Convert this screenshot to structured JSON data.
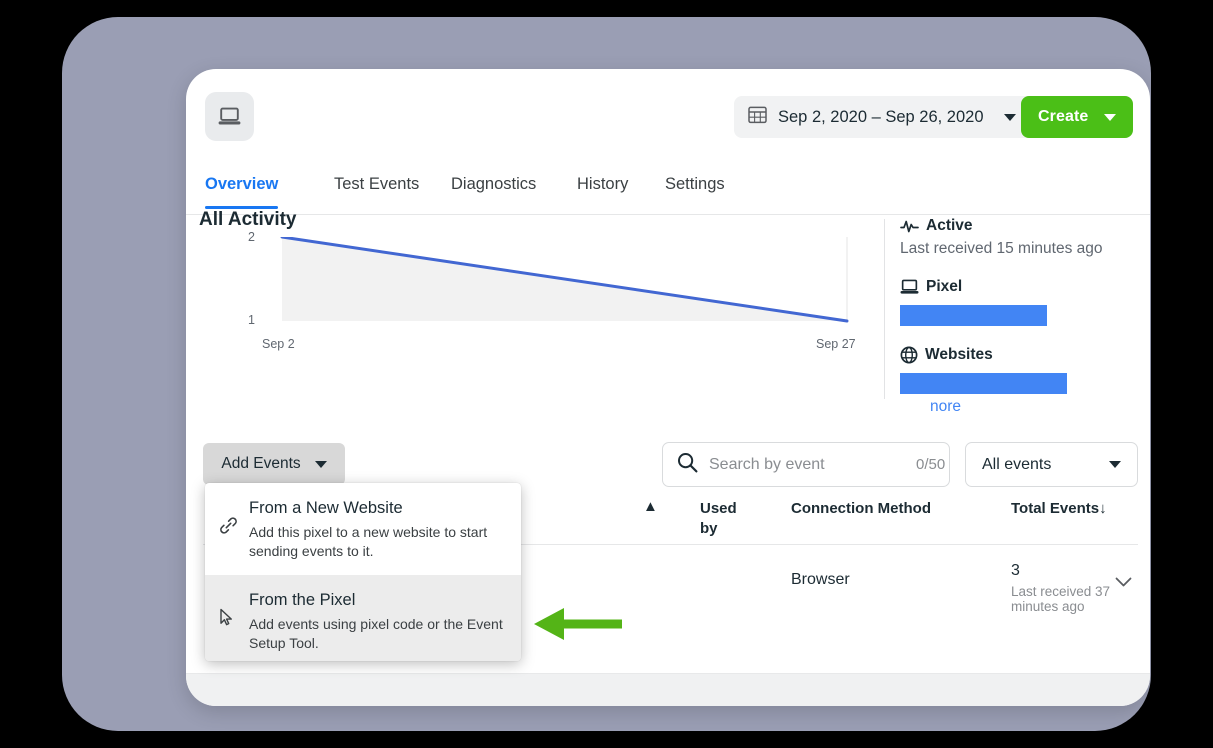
{
  "header": {
    "avatar_icon": "laptop-icon",
    "date_range": {
      "icon": "calendar-icon",
      "label": "Sep 2, 2020 – Sep 26, 2020"
    },
    "create_button": {
      "label": "Create"
    }
  },
  "tabs": [
    {
      "label": "Overview",
      "active": true
    },
    {
      "label": "Test Events",
      "active": false
    },
    {
      "label": "Diagnostics",
      "active": false
    },
    {
      "label": "History",
      "active": false
    },
    {
      "label": "Settings",
      "active": false
    }
  ],
  "activity": {
    "title": "All Activity"
  },
  "chart_data": {
    "type": "area",
    "title": "All Activity",
    "x": [
      "Sep 2",
      "Sep 27"
    ],
    "values": [
      2,
      1
    ],
    "categories": [
      "Sep 2",
      "Sep 27"
    ],
    "series": [
      {
        "name": "All Activity",
        "values": [
          2,
          1
        ]
      }
    ],
    "ytick_labels": [
      "2",
      "1"
    ],
    "xtick_labels": [
      "Sep 2",
      "Sep 27"
    ],
    "ylim": [
      1,
      2
    ],
    "ylabel": "",
    "xlabel": "",
    "grid": false,
    "legend": "none",
    "line_color": "#4267d2",
    "fill_color": "#f2f2f2"
  },
  "status_panel": {
    "active": {
      "icon": "pulse-icon",
      "label": "Active",
      "subtitle": "Last received 15 minutes ago"
    },
    "pixel": {
      "icon": "laptop-icon",
      "label": "Pixel",
      "bar_color": "#4285f4"
    },
    "websites": {
      "icon": "globe-icon",
      "label": "Websites",
      "bar_color": "#4285f4",
      "more_link": "nore"
    }
  },
  "toolbar": {
    "add_events_label": "Add Events",
    "search": {
      "icon": "search-icon",
      "placeholder": "Search by event",
      "value": "",
      "counter": "0/50"
    },
    "events_filter": {
      "selected": "All events"
    }
  },
  "add_events_menu": {
    "items": [
      {
        "icon": "link-icon",
        "title": "From a New Website",
        "description": "Add this pixel to a new website to start sending events to it.",
        "hovered": false
      },
      {
        "icon": "cursor-icon",
        "title": "From the Pixel",
        "description": "Add events using pixel code or the Event Setup Tool.",
        "hovered": true
      }
    ]
  },
  "table": {
    "columns": [
      {
        "label": "Used by"
      },
      {
        "label": "Connection Method"
      },
      {
        "label": "Total Events"
      }
    ],
    "sort_indicator": "↓",
    "rows": [
      {
        "used_by": "",
        "connection_method": "Browser",
        "total_events": "3",
        "total_events_sub": "Last received 37 minutes ago",
        "expand_icon": "chevron-down-icon"
      }
    ]
  },
  "annotation": {
    "arrow_color": "#54b417",
    "direction": "left"
  },
  "colors": {
    "accent_blue": "#1877f2",
    "chart_blue": "#4267d2",
    "bar_blue": "#4285f4",
    "create_green": "#4bbf17",
    "frame": "#9a9eb4",
    "background": "#000000"
  }
}
